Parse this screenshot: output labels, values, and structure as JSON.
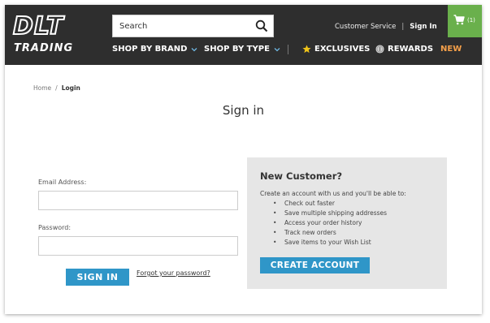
{
  "brand": {
    "logo_top": "DLT",
    "logo_bottom": "TRADING"
  },
  "search": {
    "placeholder": "Search",
    "icon": "search-icon"
  },
  "top_links": {
    "customer_service": "Customer Service",
    "separator": "|",
    "sign_in": "Sign In"
  },
  "cart": {
    "icon": "cart-icon",
    "count": "(1)",
    "color": "#6ab04c"
  },
  "nav": {
    "shop_by_brand": "SHOP BY BRAND",
    "shop_by_type": "SHOP BY TYPE",
    "exclusives": "EXCLUSIVES",
    "rewards": "REWARDS",
    "new": "NEW",
    "new_color": "#f5a04a"
  },
  "breadcrumb": {
    "home": "Home",
    "separator": "/",
    "current": "Login"
  },
  "page_title": "Sign in",
  "login_form": {
    "email_label": "Email Address:",
    "email_value": "",
    "password_label": "Password:",
    "password_value": "",
    "submit_label": "SIGN IN",
    "forgot_label": "Forgot your password?"
  },
  "new_customer": {
    "title": "New Customer?",
    "description": "Create an account with us and you'll be able to:",
    "benefits": [
      "Check out faster",
      "Save multiple shipping addresses",
      "Access your order history",
      "Track new orders",
      "Save items to your Wish List"
    ],
    "create_label": "CREATE ACCOUNT"
  },
  "colors": {
    "header_bg": "#2e2e2e",
    "accent_blue": "#2f96c8",
    "panel_bg": "#e6e6e6"
  }
}
